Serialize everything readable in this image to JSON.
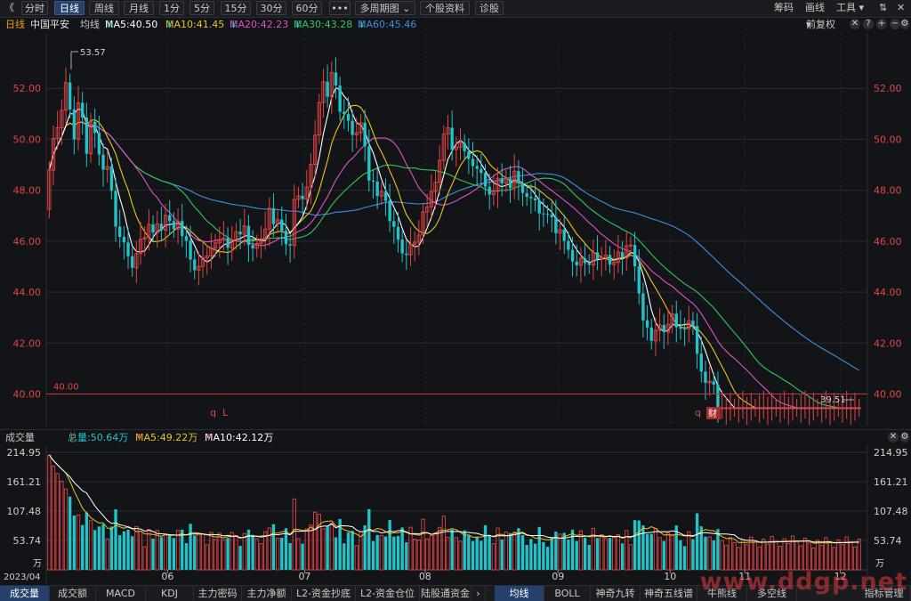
{
  "toolbar": {
    "back": "《",
    "tabs": [
      "分时",
      "日线",
      "周线",
      "月线",
      "1分",
      "5分",
      "15分",
      "30分",
      "60分",
      "•••",
      "多周期图",
      "个股资料",
      "诊股"
    ],
    "active_tab": "日线",
    "multi_caret": "⌄",
    "right": [
      "筹码",
      "画线",
      "工具"
    ],
    "tools_caret": "▾",
    "up_icon": "⇅",
    "close_icon": "✕"
  },
  "legend": {
    "period": "日线",
    "name": "中国平安",
    "ma_label": "均线",
    "ma5": "MA5:40.50",
    "ma10": "MA10:41.45",
    "ma20": "MA20:42.23",
    "ma30": "MA30:43.28",
    "ma60": "MA60:45.46",
    "arrow": "↓",
    "adjust": "前复权",
    "adjust_caret": "▾",
    "icons": [
      "✕",
      "?",
      "+",
      "−",
      "⚙"
    ]
  },
  "colors": {
    "up": "#e04545",
    "down": "#22c3c9",
    "ma5": "#ffffff",
    "ma10": "#e8c51e",
    "ma20": "#e052c8",
    "ma30": "#2ec85a",
    "ma60": "#3d8fe0",
    "grid": "#2a2b31",
    "axis_text": "#e04545",
    "line40": "#c0393b"
  },
  "chart_data": [
    {
      "type": "candlestick",
      "title": "中国平安",
      "ylim": [
        38.9,
        54.0
      ],
      "y_ticks": [
        "52.00",
        "50.00",
        "48.00",
        "46.00",
        "44.00",
        "42.00",
        "40.00"
      ],
      "x_ticks": [
        "06",
        "07",
        "08",
        "09",
        "10",
        "11",
        "12"
      ],
      "annotations": {
        "high": "53.57",
        "low": "39.51",
        "level_line": "40.00",
        "markers": [
          "q",
          "L",
          "q",
          "财"
        ]
      },
      "x": [
        0,
        1,
        2,
        3,
        4,
        5,
        6,
        7,
        8,
        9,
        10,
        11,
        12,
        13,
        14,
        15,
        16,
        17,
        18,
        19,
        20,
        21,
        22,
        23,
        24,
        25,
        26,
        27,
        28,
        29,
        30,
        31,
        32,
        33,
        34,
        35,
        36,
        37,
        38,
        39,
        40,
        41,
        42,
        43,
        44,
        45,
        46,
        47,
        48,
        49,
        50,
        51,
        52,
        53,
        54,
        55,
        56,
        57,
        58,
        59,
        60,
        61,
        62,
        63,
        64,
        65,
        66,
        67,
        68,
        69,
        70,
        71,
        72,
        73,
        74,
        75,
        76,
        77,
        78,
        79,
        80,
        81,
        82,
        83,
        84,
        85,
        86,
        87,
        88,
        89,
        90,
        91,
        92,
        93,
        94,
        95,
        96,
        97,
        98,
        99,
        100,
        101,
        102,
        103,
        104,
        105,
        106,
        107,
        108,
        109,
        110,
        111,
        112,
        113,
        114,
        115,
        116,
        117,
        118,
        119,
        120,
        121,
        122,
        123,
        124,
        125,
        126,
        127,
        128,
        129,
        130,
        131,
        132,
        133,
        134,
        135,
        136,
        137,
        138,
        139,
        140,
        141,
        142,
        143,
        144,
        145,
        146,
        147,
        148,
        149,
        150,
        151,
        152,
        153,
        154,
        155,
        156,
        157,
        158,
        159,
        160,
        161,
        162,
        163,
        164,
        165,
        166,
        167,
        168,
        169,
        170,
        171,
        172,
        173,
        174,
        175,
        176,
        177,
        178,
        179,
        180,
        181,
        182,
        183,
        184,
        185,
        186,
        187,
        188,
        189,
        190,
        191,
        192,
        193,
        194,
        195
      ],
      "open": [
        47.25,
        48.79,
        50.03,
        50.45,
        51.14,
        52.23,
        51.17,
        50.0,
        51.43,
        50.85,
        49.43,
        50.69,
        50.25,
        49.4,
        48.81,
        48.93,
        47.98,
        46.57,
        46.17,
        45.95,
        45.41,
        44.95,
        45.51,
        46.08,
        46.14,
        46.66,
        46.34,
        46.68,
        46.43,
        47.02,
        46.79,
        46.47,
        46.79,
        46.2,
        46.02,
        45.28,
        44.86,
        45.01,
        45.35,
        45.42,
        45.73,
        45.93,
        46.06,
        46.12,
        45.74,
        46.01,
        46.37,
        46.27,
        46.6,
        45.85,
        45.72,
        45.91,
        46.09,
        46.48,
        47.29,
        46.67,
        46.85,
        46.41,
        45.88,
        45.83,
        47.64,
        47.78,
        47.65,
        48.12,
        49.02,
        50.16,
        51.44,
        52.26,
        51.67,
        52.62,
        52.11,
        51.08,
        50.99,
        50.73,
        50.17,
        50.26,
        50.65,
        49.72,
        48.38,
        48.34,
        47.77,
        47.95,
        47.58,
        46.79,
        46.56,
        46.06,
        45.52,
        45.46,
        45.88,
        45.96,
        46.24,
        47.15,
        47.35,
        47.95,
        48.31,
        49.17,
        50.2,
        50.45,
        49.59,
        49.69,
        49.85,
        49.53,
        49.23,
        48.95,
        48.84,
        48.68,
        48.14,
        47.83,
        47.96,
        48.47,
        48.27,
        48.46,
        48.09,
        48.75,
        48.27,
        47.89,
        47.74,
        47.68,
        47.6,
        47.09,
        47.07,
        47.04,
        46.94,
        46.31,
        46.45,
        46.01,
        45.66,
        45.2,
        45.05,
        45.32,
        45.14,
        45.07,
        45.56,
        45.29,
        45.35,
        45.46,
        45.08,
        45.17,
        45.57,
        45.35,
        45.82,
        45.85,
        45.01,
        43.95,
        42.89,
        42.61,
        42.09,
        42.5,
        42.71,
        42.43,
        42.74,
        43.15,
        42.62,
        42.56,
        42.55,
        42.88,
        42.67,
        41.58,
        40.88,
        40.44,
        40.5,
        40.37,
        39.46,
        39.46,
        39.46,
        39.46,
        39.46,
        39.46,
        39.46,
        39.46,
        39.46,
        39.46,
        39.46,
        39.46,
        39.46,
        39.46,
        39.46,
        39.46,
        39.46,
        39.46,
        39.46,
        39.46,
        39.46,
        39.46,
        39.46,
        39.46,
        39.46,
        39.46,
        39.46,
        39.46,
        39.46,
        39.46,
        39.46,
        39.46,
        39.46,
        39.46
      ],
      "close": [
        48.79,
        50.03,
        50.45,
        51.14,
        52.23,
        51.17,
        50.0,
        51.43,
        50.85,
        49.43,
        50.69,
        50.25,
        49.4,
        48.81,
        48.93,
        47.98,
        46.57,
        46.17,
        45.95,
        45.41,
        44.95,
        45.51,
        46.08,
        46.14,
        46.66,
        46.34,
        46.68,
        46.43,
        47.02,
        46.79,
        46.47,
        46.79,
        46.2,
        46.02,
        45.28,
        44.86,
        45.01,
        45.35,
        45.42,
        45.73,
        45.93,
        46.06,
        46.12,
        45.74,
        46.01,
        46.37,
        46.27,
        46.6,
        45.85,
        45.72,
        45.91,
        46.09,
        46.48,
        47.29,
        46.67,
        46.85,
        46.41,
        45.88,
        45.83,
        47.64,
        47.78,
        47.65,
        48.12,
        49.02,
        50.16,
        51.44,
        52.26,
        51.67,
        52.62,
        52.11,
        51.08,
        50.99,
        50.73,
        50.17,
        50.26,
        50.65,
        49.72,
        48.38,
        48.34,
        47.77,
        47.95,
        47.58,
        46.79,
        46.56,
        46.06,
        45.52,
        45.46,
        45.88,
        45.96,
        46.24,
        47.15,
        47.35,
        47.95,
        48.31,
        49.17,
        50.2,
        50.45,
        49.59,
        49.69,
        49.85,
        49.53,
        49.23,
        48.95,
        48.84,
        48.68,
        48.14,
        47.83,
        47.96,
        48.47,
        48.27,
        48.46,
        48.09,
        48.75,
        48.27,
        47.89,
        47.74,
        47.68,
        47.6,
        47.09,
        47.07,
        47.04,
        46.94,
        46.31,
        46.45,
        46.01,
        45.66,
        45.2,
        45.05,
        45.32,
        45.14,
        45.07,
        45.56,
        45.29,
        45.35,
        45.46,
        45.08,
        45.17,
        45.57,
        45.35,
        45.82,
        45.85,
        45.01,
        43.95,
        42.89,
        42.61,
        42.09,
        42.5,
        42.71,
        42.43,
        42.74,
        43.15,
        42.62,
        42.56,
        42.55,
        42.88,
        42.67,
        41.58,
        40.88,
        40.44,
        40.5,
        40.37,
        39.46,
        39.46,
        39.46,
        39.46,
        39.46,
        39.46,
        39.46,
        39.46,
        39.46,
        39.46,
        39.46,
        39.46,
        39.46,
        39.46,
        39.46,
        39.46,
        39.46,
        39.46,
        39.46,
        39.46,
        39.46,
        39.46,
        39.46,
        39.46,
        39.46,
        39.46,
        39.46,
        39.46,
        39.46,
        39.46,
        39.46,
        39.46,
        39.46,
        39.46,
        39.46
      ]
    },
    {
      "type": "bar",
      "title": "成交量",
      "header": {
        "total": "总量:50.64万",
        "ma5": "MA5:49.22万",
        "ma10": "MA10:42.12万",
        "arrow": "↑"
      },
      "ylim": [
        0,
        214.95
      ],
      "y_ticks": [
        "214.95",
        "161.21",
        "107.48",
        "53.74"
      ],
      "unit": "万",
      "x_start_label": "2023/04"
    }
  ],
  "bottom_tabs": [
    "成交量",
    "成交额",
    "MACD",
    "KDJ",
    "主力密码",
    "主力净额",
    "L2-资金抄底",
    "L2-资金仓位",
    "陆股通资金",
    "均线",
    "BOLL",
    "神奇九转",
    "神奇五线谱",
    "牛熊线",
    "多空线",
    "指标管理"
  ],
  "bottom_active": [
    "成交量",
    "均线"
  ],
  "bottom_nav": "›",
  "watermark": "www.ddgp.net"
}
